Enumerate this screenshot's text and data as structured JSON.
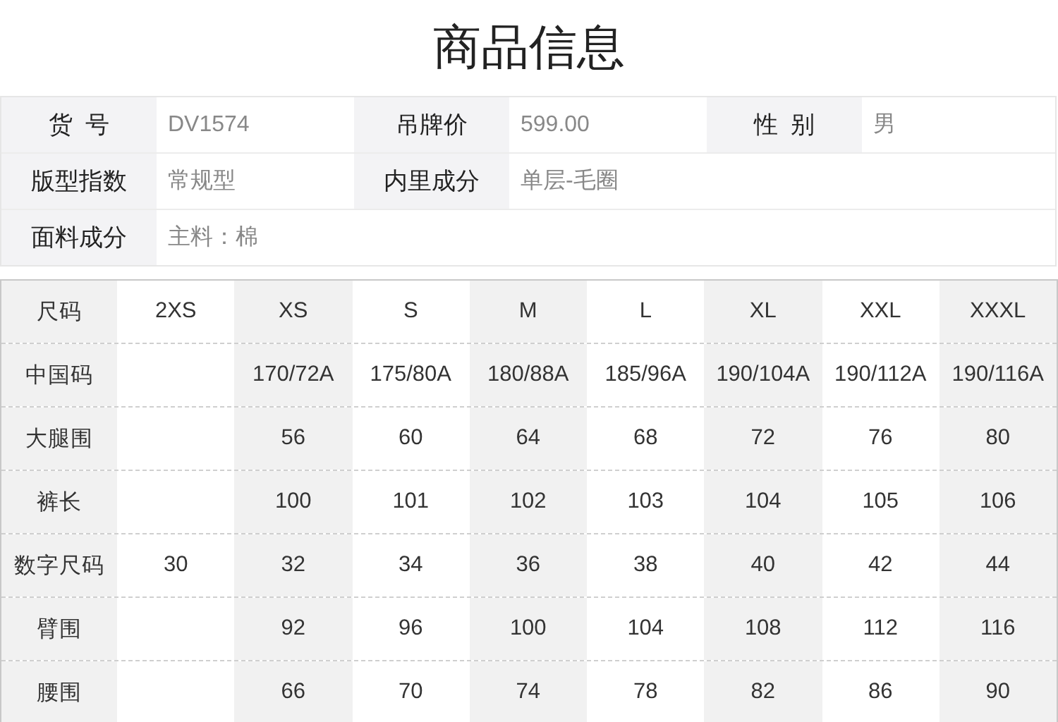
{
  "title": "商品信息",
  "info": {
    "rows": [
      {
        "fields": [
          {
            "label": "货  号",
            "value": "DV1574"
          },
          {
            "label": "吊牌价",
            "value": "599.00"
          },
          {
            "label": "性  别",
            "value": "男"
          }
        ]
      },
      {
        "fields": [
          {
            "label": "版型指数",
            "value": "常规型"
          },
          {
            "label": "内里成分",
            "value": "单层-毛圈"
          }
        ]
      },
      {
        "fields": [
          {
            "label": "面料成分",
            "value": "主料：棉"
          }
        ]
      }
    ]
  },
  "size_table": {
    "columns": [
      "尺码",
      "2XS",
      "XS",
      "S",
      "M",
      "L",
      "XL",
      "XXL",
      "XXXL"
    ],
    "rows": [
      {
        "cells": [
          "中国码",
          "",
          "170/72A",
          "175/80A",
          "180/88A",
          "185/96A",
          "190/104A",
          "190/112A",
          "190/116A"
        ]
      },
      {
        "cells": [
          "大腿围",
          "",
          "56",
          "60",
          "64",
          "68",
          "72",
          "76",
          "80"
        ]
      },
      {
        "cells": [
          "裤长",
          "",
          "100",
          "101",
          "102",
          "103",
          "104",
          "105",
          "106"
        ]
      },
      {
        "cells": [
          "数字尺码",
          "30",
          "32",
          "34",
          "36",
          "38",
          "40",
          "42",
          "44"
        ]
      },
      {
        "cells": [
          "臂围",
          "",
          "92",
          "96",
          "100",
          "104",
          "108",
          "112",
          "116"
        ]
      },
      {
        "cells": [
          "腰围",
          "",
          "66",
          "70",
          "74",
          "78",
          "82",
          "86",
          "90"
        ]
      }
    ]
  }
}
